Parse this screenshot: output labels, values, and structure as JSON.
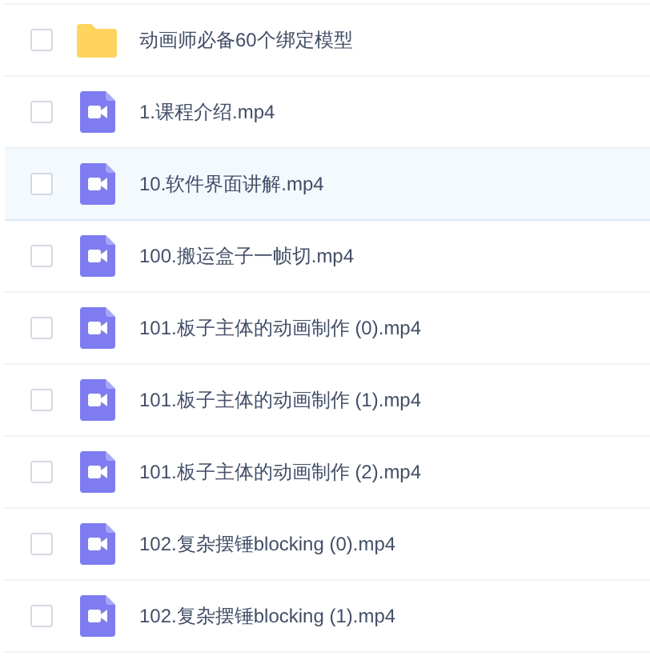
{
  "files": [
    {
      "kind": "folder",
      "name": "动画师必备60个绑定模型",
      "checked": false,
      "hovered": false
    },
    {
      "kind": "video",
      "name": "1.课程介绍.mp4",
      "checked": false,
      "hovered": false
    },
    {
      "kind": "video",
      "name": "10.软件界面讲解.mp4",
      "checked": false,
      "hovered": true
    },
    {
      "kind": "video",
      "name": "100.搬运盒子一帧切.mp4",
      "checked": false,
      "hovered": false
    },
    {
      "kind": "video",
      "name": "101.板子主体的动画制作 (0).mp4",
      "checked": false,
      "hovered": false
    },
    {
      "kind": "video",
      "name": "101.板子主体的动画制作 (1).mp4",
      "checked": false,
      "hovered": false
    },
    {
      "kind": "video",
      "name": "101.板子主体的动画制作 (2).mp4",
      "checked": false,
      "hovered": false
    },
    {
      "kind": "video",
      "name": "102.复杂摆锤blocking (0).mp4",
      "checked": false,
      "hovered": false
    },
    {
      "kind": "video",
      "name": "102.复杂摆锤blocking (1).mp4",
      "checked": false,
      "hovered": false
    }
  ]
}
